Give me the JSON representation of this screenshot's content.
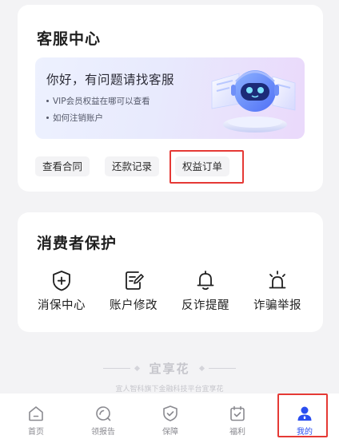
{
  "customer_service": {
    "title": "客服中心",
    "banner": {
      "title": "你好，有问题请找客服",
      "bullets": [
        "VIP会员权益在哪可以查看",
        "如何注销账户"
      ]
    },
    "quick_links": [
      "查看合同",
      "还款记录",
      "权益订单"
    ]
  },
  "consumer_protection": {
    "title": "消费者保护",
    "items": [
      {
        "label": "消保中心",
        "icon": "shield-plus-icon"
      },
      {
        "label": "账户修改",
        "icon": "edit-document-icon"
      },
      {
        "label": "反诈提醒",
        "icon": "bell-icon"
      },
      {
        "label": "诈骗举报",
        "icon": "alarm-light-icon"
      }
    ]
  },
  "footer": {
    "brand": "宜享花",
    "subtitle": "宜人智科旗下金融科技平台宜享花"
  },
  "tabbar": {
    "active": "我的",
    "active_color": "#2a4ef0",
    "tabs": [
      {
        "label": "首页",
        "icon": "home-icon"
      },
      {
        "label": "领报告",
        "icon": "report-search-icon"
      },
      {
        "label": "保障",
        "icon": "shield-check-icon"
      },
      {
        "label": "福利",
        "icon": "calendar-gift-icon"
      },
      {
        "label": "我的",
        "icon": "user-icon"
      }
    ]
  },
  "highlight_color": "#e53935"
}
